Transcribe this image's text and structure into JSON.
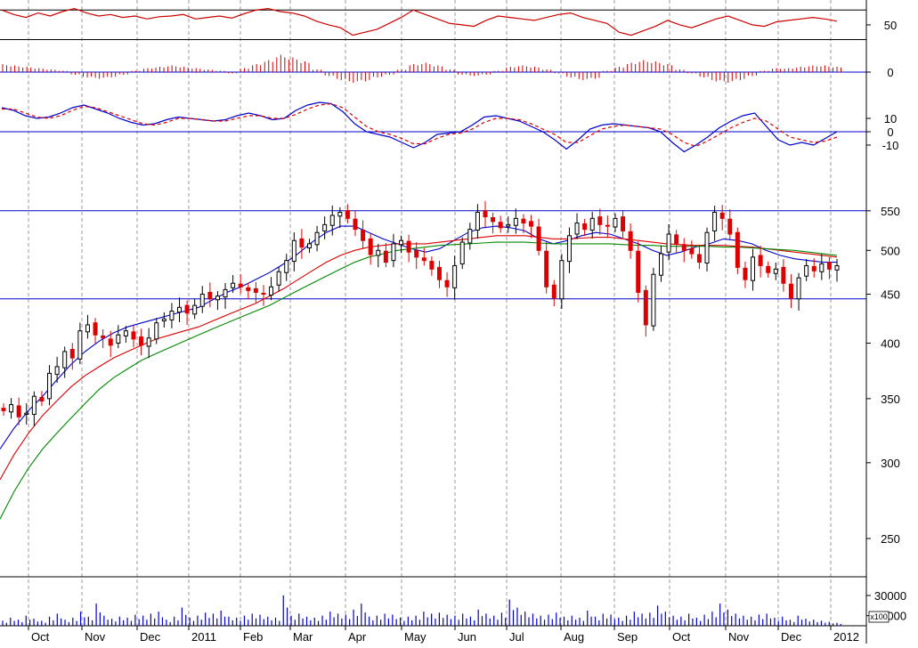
{
  "colors": {
    "background": "#ffffff",
    "grid": "#9a9a9a",
    "frame": "#000000",
    "reference_line": "#0000cc",
    "candle_up": "#000000",
    "candle_down": "#dd0000",
    "ma_fast": "#0000cc",
    "ma_mid": "#dd0000",
    "ma_slow": "#008800",
    "oscillator": "#cc0000",
    "histogram": "#cc0000",
    "macd_line": "#0000cc",
    "signal_line": "#dd0000",
    "volume": "#0000cc"
  },
  "x_axis": {
    "labels": [
      "Oct",
      "Nov",
      "Dec",
      "2011",
      "Feb",
      "Mar",
      "Apr",
      "May",
      "Jun",
      "Jul",
      "Aug",
      "Sep",
      "Oct",
      "Nov",
      "Dec",
      "2012"
    ]
  },
  "chart_data": [
    {
      "type": "line",
      "panel": "oscillator",
      "scale": "linear",
      "ylim": [
        15,
        80
      ],
      "y_ticks": [
        {
          "value": 50,
          "label": "50"
        }
      ],
      "reference_lines": [
        70,
        30
      ],
      "series": [
        {
          "style": "solid",
          "color": "#cc0000",
          "values": [
            70,
            64,
            60,
            66,
            62,
            68,
            72,
            66,
            62,
            64,
            60,
            62,
            58,
            61,
            62,
            64,
            58,
            60,
            62,
            59,
            65,
            70,
            72,
            68,
            66,
            62,
            55,
            50,
            46,
            36,
            40,
            44,
            52,
            60,
            70,
            64,
            58,
            52,
            50,
            48,
            56,
            62,
            60,
            58,
            56,
            60,
            64,
            66,
            60,
            56,
            52,
            40,
            36,
            42,
            48,
            56,
            50,
            46,
            52,
            58,
            62,
            56,
            50,
            48,
            54,
            56,
            58,
            60,
            58,
            55
          ]
        }
      ]
    },
    {
      "type": "bar",
      "panel": "histogram",
      "scale": "linear",
      "ylim": [
        -6,
        8
      ],
      "y_ticks": [
        {
          "value": 0,
          "label": "0"
        }
      ],
      "reference_lines": [
        0
      ],
      "values": [
        3,
        2.5,
        2,
        1.5,
        1,
        0.5,
        -1,
        -2,
        -2.5,
        -2,
        -1,
        0.5,
        1.5,
        2,
        2.5,
        2,
        1.5,
        1,
        0.5,
        -0.5,
        1.5,
        3,
        4.5,
        6.5,
        5.5,
        4,
        1,
        -1.5,
        -3,
        -4,
        -3.5,
        -2,
        -1,
        1,
        3,
        3.5,
        2.5,
        1,
        -1,
        -1.5,
        -1,
        0.5,
        2,
        2.5,
        2,
        1,
        -0.5,
        -2,
        -3,
        -2.5,
        0.5,
        2,
        3.5,
        4.5,
        4,
        3,
        1,
        -0.5,
        -2,
        -3.5,
        -4,
        -3,
        -1.5,
        0.5,
        1.5,
        1.5,
        2,
        2.5,
        2.5,
        2
      ]
    },
    {
      "type": "line",
      "panel": "macd",
      "scale": "linear",
      "ylim": [
        -20,
        30
      ],
      "y_ticks": [
        {
          "value": 10,
          "label": "10"
        },
        {
          "value": 0,
          "label": "0"
        },
        {
          "value": -10,
          "label": "-10"
        }
      ],
      "reference_lines": [
        0
      ],
      "series": [
        {
          "style": "solid",
          "color": "#0000cc",
          "values": [
            18,
            16,
            12,
            10,
            11,
            14,
            18,
            20,
            17,
            14,
            10,
            7,
            5,
            6,
            9,
            11,
            10,
            9,
            8,
            9,
            12,
            14,
            12,
            9,
            10,
            16,
            20,
            22,
            21,
            15,
            6,
            0,
            -2,
            -4,
            -8,
            -12,
            -8,
            -2,
            -1,
            0,
            5,
            11,
            12,
            10,
            8,
            4,
            0,
            -6,
            -13,
            -6,
            2,
            5,
            6,
            5,
            4,
            3,
            0,
            -8,
            -15,
            -10,
            -4,
            3,
            8,
            12,
            14,
            4,
            -6,
            -10,
            -8,
            -10,
            -5,
            0
          ]
        },
        {
          "style": "dashed",
          "color": "#dd0000",
          "values": [
            17,
            17,
            14,
            11,
            10,
            12,
            16,
            19,
            18,
            15,
            12,
            9,
            6,
            5,
            7,
            10,
            10,
            9,
            8,
            8,
            10,
            12,
            12,
            10,
            10,
            13,
            17,
            20,
            21,
            18,
            11,
            4,
            0,
            -2,
            -5,
            -9,
            -9,
            -5,
            -2,
            -1,
            2,
            7,
            10,
            10,
            9,
            6,
            2,
            -2,
            -8,
            -8,
            -3,
            2,
            4,
            5,
            4,
            3,
            2,
            -2,
            -8,
            -11,
            -7,
            -2,
            3,
            7,
            10,
            8,
            2,
            -4,
            -6,
            -8,
            -7,
            -4
          ]
        }
      ]
    },
    {
      "type": "line",
      "panel": "price",
      "scale": "log",
      "ylim": [
        228,
        580
      ],
      "y_ticks": [
        {
          "value": 550,
          "label": "550"
        },
        {
          "value": 500,
          "label": "500"
        },
        {
          "value": 450,
          "label": "450"
        },
        {
          "value": 400,
          "label": "400"
        },
        {
          "value": 350,
          "label": "350"
        },
        {
          "value": 300,
          "label": "300"
        },
        {
          "value": 250,
          "label": "250"
        }
      ],
      "reference_lines": [
        550,
        445
      ],
      "candles": [
        340,
        345,
        335,
        338,
        352,
        348,
        372,
        378,
        392,
        386,
        412,
        418,
        408,
        405,
        398,
        408,
        412,
        404,
        398,
        405,
        420,
        424,
        432,
        436,
        430,
        438,
        450,
        445,
        448,
        455,
        462,
        458,
        454,
        452,
        450,
        458,
        475,
        488,
        512,
        504,
        508,
        522,
        532,
        544,
        548,
        540,
        526,
        512,
        495,
        500,
        486,
        508,
        512,
        498,
        492,
        488,
        478,
        466,
        458,
        482,
        510,
        526,
        548,
        542,
        536,
        528,
        532,
        540,
        534,
        530,
        500,
        458,
        446,
        488,
        518,
        534,
        526,
        540,
        532,
        530,
        540,
        524,
        500,
        452,
        418,
        472,
        496,
        520,
        508,
        500,
        496,
        486,
        522,
        548,
        540,
        520,
        480,
        466,
        492,
        482,
        474,
        478,
        462,
        446,
        468,
        482,
        476,
        484,
        478,
        482
      ],
      "series": [
        {
          "name": "",
          "color": "#0000cc",
          "values": [
            310,
            326,
            340,
            352,
            366,
            380,
            392,
            402,
            410,
            416,
            420,
            424,
            428,
            432,
            436,
            444,
            452,
            458,
            466,
            474,
            484,
            496,
            510,
            522,
            530,
            530,
            522,
            514,
            508,
            502,
            498,
            502,
            512,
            522,
            528,
            530,
            528,
            524,
            514,
            508,
            512,
            518,
            522,
            520,
            514,
            508,
            500,
            494,
            498,
            504,
            508,
            514,
            512,
            508,
            500,
            494,
            490,
            488,
            486,
            486
          ]
        },
        {
          "name": "",
          "color": "#dd0000",
          "values": [
            288,
            306,
            322,
            336,
            348,
            360,
            370,
            378,
            386,
            392,
            398,
            404,
            408,
            412,
            416,
            422,
            428,
            434,
            440,
            448,
            456,
            466,
            476,
            486,
            494,
            500,
            504,
            506,
            508,
            508,
            508,
            510,
            512,
            514,
            516,
            518,
            518,
            518,
            516,
            514,
            514,
            515,
            516,
            516,
            514,
            512,
            510,
            508,
            507,
            506,
            506,
            506,
            505,
            504,
            502,
            500,
            498,
            496,
            494,
            492
          ]
        },
        {
          "name": "",
          "color": "#008800",
          "values": [
            262,
            280,
            296,
            310,
            322,
            334,
            346,
            358,
            368,
            376,
            384,
            390,
            396,
            402,
            408,
            414,
            420,
            426,
            432,
            438,
            446,
            454,
            462,
            470,
            478,
            486,
            492,
            496,
            500,
            502,
            504,
            506,
            507,
            508,
            509,
            510,
            510,
            510,
            509,
            508,
            508,
            508,
            508,
            508,
            507,
            506,
            506,
            505,
            505,
            505,
            505,
            504,
            504,
            503,
            502,
            501,
            500,
            498,
            496,
            494
          ]
        }
      ]
    },
    {
      "type": "bar",
      "panel": "volume",
      "scale": "linear",
      "ylim": [
        0,
        45000
      ],
      "y_ticks": [
        {
          "value": 30000,
          "label": "30000"
        },
        {
          "value": 10000,
          "label": "10000"
        }
      ],
      "unit_label": "x100",
      "values": [
        5000,
        8000,
        6000,
        10000,
        7000,
        5000,
        9000,
        12000,
        6000,
        8000,
        14000,
        9000,
        22000,
        10000,
        7000,
        9000,
        8000,
        11000,
        10000,
        12000,
        14000,
        6000,
        9000,
        18000,
        8000,
        10000,
        13000,
        12000,
        15000,
        9000,
        8000,
        10000,
        12000,
        11000,
        9000,
        8000,
        30000,
        10000,
        12000,
        9000,
        8000,
        10000,
        14000,
        12000,
        11000,
        16000,
        22000,
        9000,
        10000,
        12000,
        11000,
        8000,
        9000,
        10000,
        14000,
        12000,
        13000,
        11000,
        10000,
        12000,
        9000,
        16000,
        12000,
        10000,
        13000,
        26000,
        18000,
        14000,
        12000,
        10000,
        11000,
        13000,
        9000,
        10000,
        8000,
        15000,
        9000,
        12000,
        11000,
        8000,
        10000,
        14000,
        12000,
        13000,
        20000,
        14000,
        10000,
        9000,
        12000,
        8000,
        11000,
        14000,
        22000,
        16000,
        12000,
        10000,
        9000,
        11000,
        12000,
        8000,
        9000,
        6000,
        10000,
        7000,
        6000,
        5000,
        4000,
        3000
      ]
    }
  ]
}
